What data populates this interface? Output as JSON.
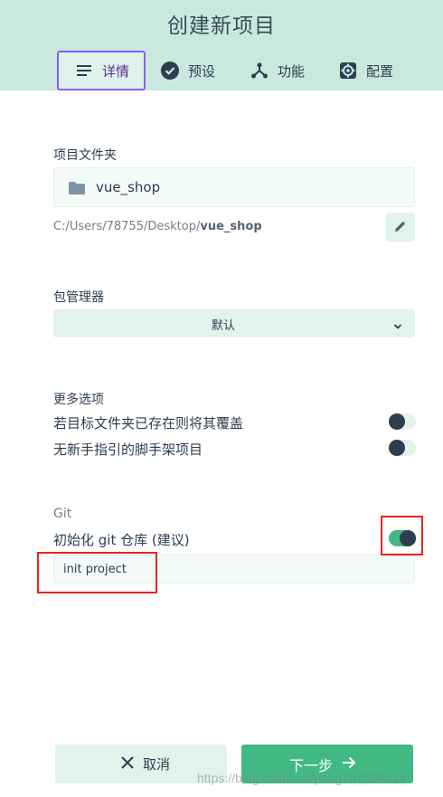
{
  "header": {
    "title": "创建新项目",
    "tabs": [
      {
        "label": "详情",
        "icon": "list-icon"
      },
      {
        "label": "预设",
        "icon": "check-circle-icon"
      },
      {
        "label": "功能",
        "icon": "fork-icon"
      },
      {
        "label": "配置",
        "icon": "gear-icon"
      }
    ]
  },
  "folder": {
    "label": "项目文件夹",
    "value": "vue_shop",
    "path_prefix": "C:/Users/78755/Desktop/",
    "path_name": "vue_shop"
  },
  "package_manager": {
    "label": "包管理器",
    "value": "默认"
  },
  "more_options": {
    "label": "更多选项",
    "items": [
      {
        "label": "若目标文件夹已存在则将其覆盖",
        "enabled": false
      },
      {
        "label": "无新手指引的脚手架项目",
        "enabled": false
      }
    ]
  },
  "git": {
    "label": "Git",
    "init_label": "初始化 git 仓库 (建议)",
    "init_enabled": true,
    "commit_message": "init project"
  },
  "footer": {
    "cancel_label": "取消",
    "next_label": "下一步"
  },
  "watermark": "https://blog.csdn.net/pang787559613",
  "colors": {
    "accent": "#42b983",
    "header_bg": "#c9e9de",
    "active_tab_border": "#8b5cf6",
    "highlight": "#e8231f"
  }
}
